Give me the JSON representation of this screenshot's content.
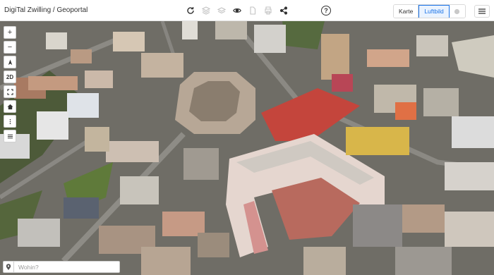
{
  "app": {
    "title": "DigiTal Zwilling / Geoportal"
  },
  "toolbar": {
    "icons": [
      "reload-icon",
      "layers-icon",
      "stack-icon",
      "eye-icon",
      "file-icon",
      "print-icon",
      "share-icon",
      "help-icon"
    ],
    "help_label": "?"
  },
  "basemap": {
    "options": [
      "Karte",
      "Luftbild"
    ],
    "selected": "Luftbild"
  },
  "controls": {
    "zoom_in": "+",
    "zoom_out": "−",
    "view_mode": "2D"
  },
  "search": {
    "placeholder": "Wohin?"
  },
  "colors": {
    "accent": "#1a73e8",
    "roof_red": "#c4453c",
    "plaza": "#b86a5e"
  }
}
